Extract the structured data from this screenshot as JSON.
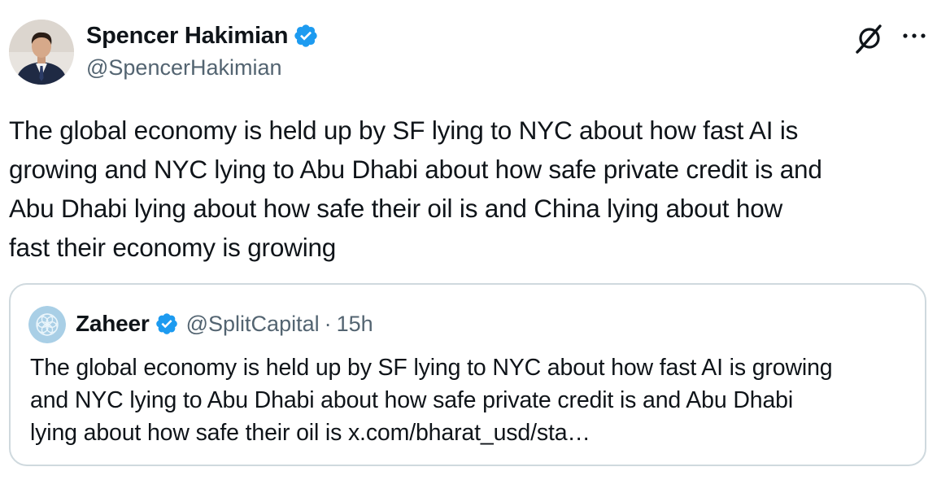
{
  "author": {
    "display_name": "Spencer Hakimian",
    "handle": "@SpencerHakimian",
    "verified_icon": "verified-badge-icon"
  },
  "actions": {
    "grok_icon": "grok-icon",
    "more_icon": "more-icon"
  },
  "tweet": {
    "text": "The global economy is held up by SF lying to NYC about how fast AI is\ngrowing and NYC lying to Abu Dhabi about how safe private credit is and\nAbu Dhabi lying about how safe their oil is and China lying about how\nfast their economy is growing"
  },
  "quote": {
    "display_name": "Zaheer",
    "handle": "@SplitCapital",
    "separator": "·",
    "time": "15h",
    "text": "The global economy is held up by SF lying to NYC about how fast AI is growing\nand NYC lying to Abu Dhabi about how safe private credit is and Abu Dhabi\nlying about how safe their oil is x.com/bharat_usd/sta…"
  },
  "colors": {
    "text_primary": "#0f1419",
    "text_secondary": "#536471",
    "verified_blue": "#1d9bf0",
    "card_border": "#cfd9de"
  }
}
